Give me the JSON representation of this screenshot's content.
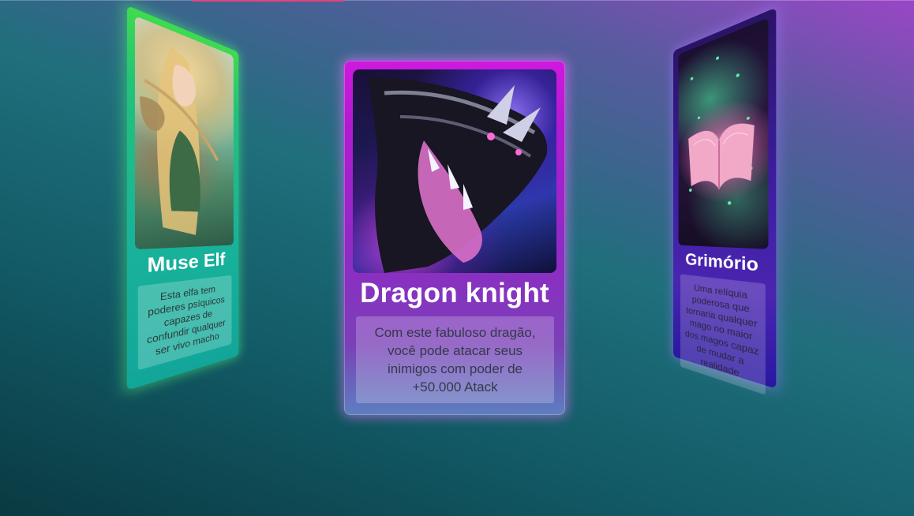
{
  "cards": {
    "left": {
      "title": "Muse Elf",
      "description": "Esta elfa tem poderes psíquicos capazes de confundir qualquer ser vivo macho",
      "image_icon": "elf-archer-image"
    },
    "center": {
      "title": "Dragon knight",
      "description": "Com este fabuloso dragão, você pode atacar seus inimigos com poder de +50.000 Atack",
      "image_icon": "dragon-image"
    },
    "right": {
      "title": "Grimório",
      "description": "Uma relíquia poderosa que tornaria qualquer mago no maior dos magos capaz de mudar a realidade",
      "image_icon": "grimoire-book-image"
    }
  },
  "colors": {
    "center_card": "#b21ad2",
    "left_card": "#19b39a",
    "right_card": "#3c1da0",
    "accent_line": "#e0457a"
  }
}
